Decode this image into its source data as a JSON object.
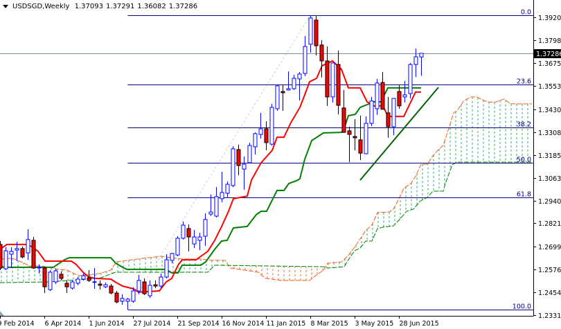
{
  "header": {
    "symbol": "USDSGD,Weekly",
    "open": "1.37093",
    "high": "1.37291",
    "low": "1.36082",
    "close": "1.37286"
  },
  "colors": {
    "bull": "#0000ff",
    "bear": "#ff0000",
    "tenkan": "#ff0000",
    "kijun": "#008000",
    "cloud_up": "#22b060",
    "cloud_down": "#ff5a1a",
    "fib": "#000080",
    "price_line": "#778899",
    "trendline": "#006400"
  },
  "chart_data": {
    "type": "candlestick",
    "title": "USDSGD,Weekly",
    "xlabel": "",
    "ylabel": "",
    "ylim": [
      1.2285,
      1.4013
    ],
    "grid": false,
    "x_tick_labels": [
      {
        "index": 0,
        "label": "9 Feb 2014"
      },
      {
        "index": 8,
        "label": "6 Apr 2014"
      },
      {
        "index": 16,
        "label": "1 Jun 2014"
      },
      {
        "index": 24,
        "label": "27 Jul 2014"
      },
      {
        "index": 32,
        "label": "21 Sep 2014"
      },
      {
        "index": 40,
        "label": "16 Nov 2014"
      },
      {
        "index": 48,
        "label": "11 Jan 2015"
      },
      {
        "index": 56,
        "label": "8 Mar 2015"
      },
      {
        "index": 64,
        "label": "3 May 2015"
      },
      {
        "index": 72,
        "label": "28 Jun 2015"
      }
    ],
    "y_tick_labels": [
      "1.39205",
      "1.37980",
      "1.36755",
      "1.35530",
      "1.34305",
      "1.33080",
      "1.31855",
      "1.30630",
      "1.29405",
      "1.28215",
      "1.26990",
      "1.25765",
      "1.24540",
      "1.23315"
    ],
    "last_price": "1.37286",
    "ohlc": [
      [
        1.2709,
        1.2727,
        1.2572,
        1.2583
      ],
      [
        1.2579,
        1.2694,
        1.2572,
        1.2675
      ],
      [
        1.2657,
        1.2694,
        1.2583,
        1.2672
      ],
      [
        1.2679,
        1.2723,
        1.262,
        1.2687
      ],
      [
        1.2687,
        1.2698,
        1.2635,
        1.2642
      ],
      [
        1.2664,
        1.279,
        1.2627,
        1.2735
      ],
      [
        1.2731,
        1.2749,
        1.2579,
        1.2583
      ],
      [
        1.2583,
        1.2602,
        1.2554,
        1.2587
      ],
      [
        1.2583,
        1.259,
        1.245,
        1.2483
      ],
      [
        1.2468,
        1.2572,
        1.2461,
        1.2561
      ],
      [
        1.2509,
        1.2579,
        1.2498,
        1.2568
      ],
      [
        1.255,
        1.2565,
        1.2517,
        1.2528
      ],
      [
        1.2502,
        1.2517,
        1.245,
        1.2483
      ],
      [
        1.2476,
        1.2517,
        1.2468,
        1.2509
      ],
      [
        1.2502,
        1.2535,
        1.2491,
        1.2524
      ],
      [
        1.2524,
        1.2554,
        1.2517,
        1.2542
      ],
      [
        1.2531,
        1.2572,
        1.2509,
        1.2517
      ],
      [
        1.2509,
        1.2583,
        1.2472,
        1.251
      ],
      [
        1.2498,
        1.2517,
        1.2468,
        1.2491
      ],
      [
        1.2483,
        1.2506,
        1.2476,
        1.2494
      ],
      [
        1.2487,
        1.2498,
        1.2443,
        1.245
      ],
      [
        1.245,
        1.2461,
        1.2395,
        1.2402
      ],
      [
        1.2406,
        1.2443,
        1.2387,
        1.2421
      ],
      [
        1.2406,
        1.2424,
        1.2361,
        1.2417
      ],
      [
        1.2406,
        1.248,
        1.2398,
        1.2461
      ],
      [
        1.2461,
        1.2546,
        1.2443,
        1.2517
      ],
      [
        1.2509,
        1.2528,
        1.2439,
        1.2446
      ],
      [
        1.2435,
        1.2517,
        1.2424,
        1.2491
      ],
      [
        1.2494,
        1.2517,
        1.2476,
        1.2487
      ],
      [
        1.2487,
        1.2554,
        1.2476,
        1.2535
      ],
      [
        1.2535,
        1.2657,
        1.2528,
        1.2627
      ],
      [
        1.2624,
        1.2664,
        1.2609,
        1.2661
      ],
      [
        1.2653,
        1.2753,
        1.2646,
        1.2742
      ],
      [
        1.2742,
        1.2831,
        1.2735,
        1.2812
      ],
      [
        1.2794,
        1.2816,
        1.2672,
        1.2749
      ],
      [
        1.2712,
        1.2786,
        1.269,
        1.2749
      ],
      [
        1.2731,
        1.2771,
        1.2679,
        1.2749
      ],
      [
        1.2753,
        1.2875,
        1.2701,
        1.2842
      ],
      [
        1.2871,
        1.2975,
        1.286,
        1.2882
      ],
      [
        1.286,
        1.3015,
        1.2853,
        1.2964
      ],
      [
        1.2953,
        1.3097,
        1.2934,
        1.2986
      ],
      [
        1.2982,
        1.3045,
        1.296,
        1.303
      ],
      [
        1.3023,
        1.3233,
        1.3015,
        1.3219
      ],
      [
        1.3215,
        1.3241,
        1.3078,
        1.313
      ],
      [
        1.3111,
        1.3178,
        1.3001,
        1.3137
      ],
      [
        1.3145,
        1.3252,
        1.3141,
        1.3237
      ],
      [
        1.323,
        1.3307,
        1.3189,
        1.33
      ],
      [
        1.3296,
        1.3411,
        1.3274,
        1.3326
      ],
      [
        1.3326,
        1.3366,
        1.3211,
        1.3252
      ],
      [
        1.3244,
        1.3459,
        1.3237,
        1.344
      ],
      [
        1.3433,
        1.3559,
        1.3422,
        1.3555
      ],
      [
        1.3525,
        1.3559,
        1.3422,
        1.3518
      ],
      [
        1.3533,
        1.3632,
        1.353,
        1.354
      ],
      [
        1.354,
        1.3614,
        1.3533,
        1.3595
      ],
      [
        1.3592,
        1.3629,
        1.3477,
        1.3618
      ],
      [
        1.3621,
        1.3821,
        1.3607,
        1.3765
      ],
      [
        1.3777,
        1.3928,
        1.3732,
        1.3917
      ],
      [
        1.3906,
        1.3928,
        1.3717,
        1.3769
      ],
      [
        1.3773,
        1.3799,
        1.3599,
        1.3688
      ],
      [
        1.3688,
        1.3765,
        1.3448,
        1.3496
      ],
      [
        1.3496,
        1.3677,
        1.3466,
        1.3677
      ],
      [
        1.3669,
        1.3743,
        1.3403,
        1.3451
      ],
      [
        1.3437,
        1.3533,
        1.3304,
        1.3307
      ],
      [
        1.3315,
        1.3337,
        1.3148,
        1.3296
      ],
      [
        1.3285,
        1.3377,
        1.3211,
        1.3278
      ],
      [
        1.3267,
        1.3396,
        1.3159,
        1.3196
      ],
      [
        1.3193,
        1.3392,
        1.319,
        1.3355
      ],
      [
        1.3355,
        1.3496,
        1.334,
        1.3474
      ],
      [
        1.3433,
        1.3592,
        1.34,
        1.357
      ],
      [
        1.3573,
        1.3629,
        1.3433,
        1.343
      ],
      [
        1.3411,
        1.3496,
        1.3278,
        1.3337
      ],
      [
        1.3337,
        1.3488,
        1.3292,
        1.3488
      ],
      [
        1.3525,
        1.3559,
        1.3433,
        1.3448
      ],
      [
        1.3496,
        1.3581,
        1.3466,
        1.3507
      ],
      [
        1.3514,
        1.3677,
        1.3488,
        1.3669
      ],
      [
        1.3669,
        1.3754,
        1.3603,
        1.371
      ],
      [
        1.37093,
        1.37291,
        1.36082,
        1.37286
      ]
    ],
    "ichimoku": {
      "tenkan": [
        [
          0,
          1.2683
        ],
        [
          1.25,
          1.2709
        ],
        [
          5,
          1.2709
        ],
        [
          5.88,
          1.2694
        ],
        [
          6.88,
          1.2672
        ],
        [
          8.13,
          1.262
        ],
        [
          12.88,
          1.262
        ],
        [
          13.75,
          1.2602
        ],
        [
          15,
          1.2561
        ],
        [
          16,
          1.2535
        ],
        [
          17.13,
          1.2528
        ],
        [
          20,
          1.2524
        ],
        [
          21,
          1.2505
        ],
        [
          22.13,
          1.2487
        ],
        [
          24.13,
          1.2472
        ],
        [
          25,
          1.2454
        ],
        [
          28.75,
          1.2461
        ],
        [
          30,
          1.2509
        ],
        [
          31,
          1.2528
        ],
        [
          32.13,
          1.2598
        ],
        [
          32.88,
          1.2627
        ],
        [
          35.38,
          1.2627
        ],
        [
          36.25,
          1.2646
        ],
        [
          37.5,
          1.2672
        ],
        [
          38.75,
          1.2731
        ],
        [
          40,
          1.2805
        ],
        [
          41.25,
          1.2886
        ],
        [
          42.13,
          1.2953
        ],
        [
          44.63,
          1.2967
        ],
        [
          45.38,
          1.3052
        ],
        [
          47.13,
          1.3145
        ],
        [
          49.13,
          1.3211
        ],
        [
          50,
          1.3281
        ],
        [
          51.25,
          1.3281
        ],
        [
          52.5,
          1.3359
        ],
        [
          54.13,
          1.344
        ],
        [
          55,
          1.3507
        ],
        [
          55.88,
          1.3577
        ],
        [
          57.13,
          1.3595
        ],
        [
          58.13,
          1.3662
        ],
        [
          60,
          1.3688
        ],
        [
          61.63,
          1.3643
        ],
        [
          62.88,
          1.3544
        ],
        [
          65,
          1.3544
        ],
        [
          66.25,
          1.347
        ],
        [
          67.5,
          1.3448
        ],
        [
          69.13,
          1.3448
        ],
        [
          70,
          1.3392
        ],
        [
          72.88,
          1.3392
        ],
        [
          75,
          1.3522
        ],
        [
          76,
          1.3522
        ]
      ],
      "kijun": [
        [
          0,
          1.2598
        ],
        [
          0.63,
          1.2587
        ],
        [
          9.63,
          1.2587
        ],
        [
          11.63,
          1.2627
        ],
        [
          12.5,
          1.2638
        ],
        [
          20,
          1.2638
        ],
        [
          20.88,
          1.2609
        ],
        [
          22.13,
          1.2587
        ],
        [
          22.88,
          1.2576
        ],
        [
          30,
          1.2576
        ],
        [
          31,
          1.2557
        ],
        [
          32.13,
          1.2557
        ],
        [
          32.88,
          1.2598
        ],
        [
          36.25,
          1.2598
        ],
        [
          37.13,
          1.2616
        ],
        [
          38.75,
          1.2683
        ],
        [
          40,
          1.2727
        ],
        [
          41,
          1.2731
        ],
        [
          42.13,
          1.2797
        ],
        [
          44.63,
          1.2805
        ],
        [
          46.25,
          1.2868
        ],
        [
          47.13,
          1.2886
        ],
        [
          48.13,
          1.2886
        ],
        [
          50,
          1.2997
        ],
        [
          51.25,
          1.2997
        ],
        [
          52.13,
          1.3034
        ],
        [
          53.75,
          1.3052
        ],
        [
          54.13,
          1.306
        ],
        [
          55,
          1.3163
        ],
        [
          56.25,
          1.3263
        ],
        [
          58.38,
          1.3304
        ],
        [
          61.63,
          1.3307
        ],
        [
          62.13,
          1.3329
        ],
        [
          62.88,
          1.3396
        ],
        [
          64.13,
          1.3403
        ],
        [
          65,
          1.344
        ],
        [
          66.63,
          1.3459
        ],
        [
          67.13,
          1.347
        ],
        [
          68.75,
          1.347
        ],
        [
          70,
          1.3544
        ],
        [
          76,
          1.3544
        ]
      ],
      "span_a": [
        [
          0,
          1.2631
        ],
        [
          2.25,
          1.2635
        ],
        [
          4.38,
          1.2609
        ],
        [
          5.25,
          1.2594
        ],
        [
          7.5,
          1.2594
        ],
        [
          10.63,
          1.2576
        ],
        [
          12.13,
          1.2572
        ],
        [
          14.13,
          1.2542
        ],
        [
          17.88,
          1.2553
        ],
        [
          20,
          1.2572
        ],
        [
          21,
          1.2616
        ],
        [
          25.88,
          1.2635
        ],
        [
          29.13,
          1.2646
        ],
        [
          32.88,
          1.2631
        ],
        [
          36.25,
          1.2631
        ],
        [
          38.13,
          1.2624
        ],
        [
          40.63,
          1.2624
        ],
        [
          41.63,
          1.2583
        ],
        [
          46.63,
          1.2561
        ],
        [
          47.88,
          1.2528
        ],
        [
          50.88,
          1.2517
        ],
        [
          55.88,
          1.2517
        ],
        [
          57.13,
          1.2546
        ],
        [
          58.38,
          1.2572
        ],
        [
          59.13,
          1.2609
        ],
        [
          61.63,
          1.2616
        ],
        [
          62.75,
          1.2646
        ],
        [
          64,
          1.2694
        ],
        [
          65,
          1.2738
        ],
        [
          66,
          1.2783
        ],
        [
          67.13,
          1.2812
        ],
        [
          68.13,
          1.2879
        ],
        [
          70.25,
          1.2882
        ],
        [
          71,
          1.2897
        ],
        [
          72.13,
          1.296
        ],
        [
          72.88,
          1.3008
        ],
        [
          74.13,
          1.3034
        ],
        [
          75,
          1.3071
        ],
        [
          76,
          1.3137
        ],
        [
          77.13,
          1.3137
        ],
        [
          78.13,
          1.3182
        ],
        [
          79,
          1.3211
        ],
        [
          80,
          1.3237
        ],
        [
          81,
          1.3329
        ],
        [
          81.88,
          1.3411
        ],
        [
          82.5,
          1.3422
        ],
        [
          83.75,
          1.3477
        ],
        [
          85,
          1.3496
        ],
        [
          86,
          1.3496
        ],
        [
          87.88,
          1.347
        ],
        [
          89.13,
          1.3466
        ],
        [
          91,
          1.3485
        ],
        [
          92.13,
          1.3459
        ],
        [
          96,
          1.3459
        ]
      ],
      "span_b": [
        [
          0,
          1.2505
        ],
        [
          8.75,
          1.2509
        ],
        [
          17.88,
          1.2528
        ],
        [
          20.88,
          1.2561
        ],
        [
          37.5,
          1.2561
        ],
        [
          38.75,
          1.2598
        ],
        [
          58.75,
          1.259
        ],
        [
          59.13,
          1.2583
        ],
        [
          62.13,
          1.259
        ],
        [
          62.88,
          1.2627
        ],
        [
          64,
          1.2675
        ],
        [
          65,
          1.269
        ],
        [
          66,
          1.2727
        ],
        [
          67.13,
          1.2727
        ],
        [
          68.13,
          1.2794
        ],
        [
          69.13,
          1.2801
        ],
        [
          71,
          1.2808
        ],
        [
          72.13,
          1.2842
        ],
        [
          73.38,
          1.2886
        ],
        [
          74.63,
          1.2897
        ],
        [
          75.88,
          1.2941
        ],
        [
          77.13,
          1.296
        ],
        [
          78.13,
          1.2993
        ],
        [
          80,
          1.2993
        ],
        [
          80.38,
          1.3034
        ],
        [
          81.63,
          1.3134
        ],
        [
          82.5,
          1.3148
        ],
        [
          96,
          1.3148
        ]
      ]
    },
    "trendline": [
      [
        65,
        1.3052
      ],
      [
        79.13,
        1.3547
      ]
    ],
    "fibonacci": {
      "high": {
        "index": 56,
        "price": 1.3932
      },
      "low": {
        "index": 23,
        "price": 1.2361
      },
      "levels": [
        {
          "ratio": 0.0,
          "label": "0.0"
        },
        {
          "ratio": 0.236,
          "label": "23.6"
        },
        {
          "ratio": 0.382,
          "label": "38.2"
        },
        {
          "ratio": 0.5,
          "label": "50.0"
        },
        {
          "ratio": 0.618,
          "label": "61.8"
        },
        {
          "ratio": 1.0,
          "label": "100.0"
        }
      ]
    }
  }
}
